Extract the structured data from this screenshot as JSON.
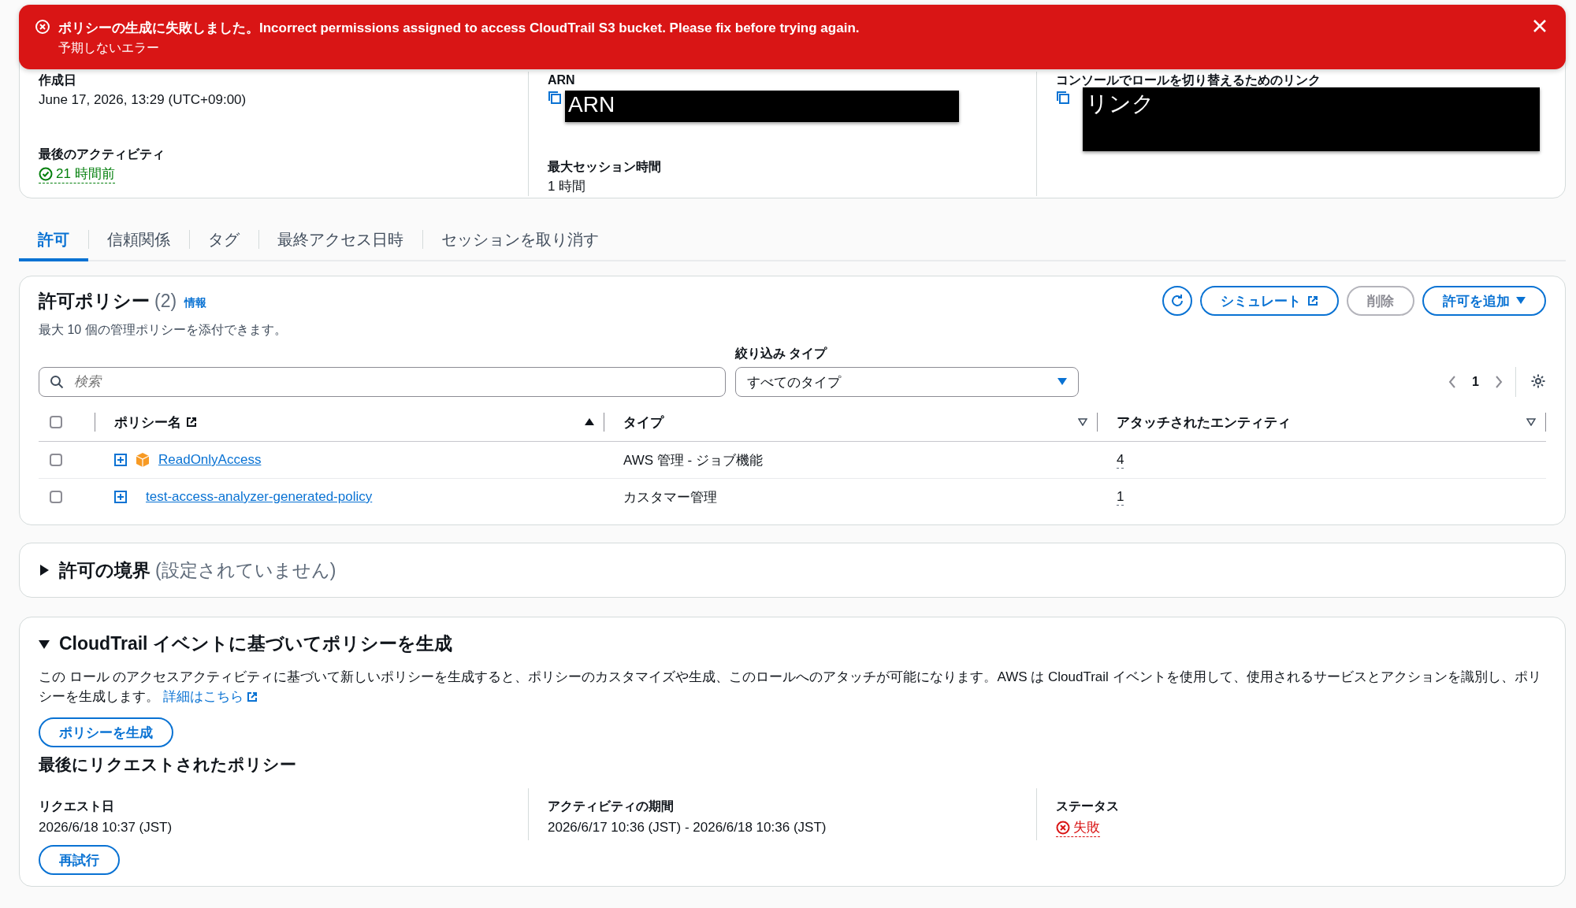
{
  "alert": {
    "message": "ポリシーの生成に失敗しました。Incorrect permissions assigned to access CloudTrail S3 bucket. Please fix before trying again.",
    "detail": "予期しないエラー"
  },
  "summary": {
    "columns": [
      [
        {
          "label": "作成日",
          "value": "June 17, 2026, 13:29 (UTC+09:00)",
          "kind": "text"
        },
        {
          "label": "最後のアクティビティ",
          "value": "21 時間前",
          "kind": "success"
        }
      ],
      [
        {
          "label": "ARN",
          "value": "ARN",
          "kind": "redacted"
        },
        {
          "label": "最大セッション時間",
          "value": "1 時間",
          "kind": "text"
        }
      ],
      [
        {
          "label": "コンソールでロールを切り替えるためのリンク",
          "value": "リンク",
          "kind": "redacted-tall"
        }
      ]
    ]
  },
  "tabs": [
    {
      "label": "許可",
      "selected": true
    },
    {
      "label": "信頼関係",
      "selected": false
    },
    {
      "label": "タグ",
      "selected": false
    },
    {
      "label": "最終アクセス日時",
      "selected": false
    },
    {
      "label": "セッションを取り消す",
      "selected": false
    }
  ],
  "permissions": {
    "title": "許可ポリシー",
    "count": "(2)",
    "info": "情報",
    "description": "最大 10 個の管理ポリシーを添付できます。",
    "buttons": [
      {
        "label": "シミュレート",
        "kind": "external",
        "disabled": false
      },
      {
        "label": "削除",
        "kind": "plain",
        "disabled": true
      },
      {
        "label": "許可を追加",
        "kind": "dropdown",
        "disabled": false
      }
    ],
    "search": {
      "placeholder": "検索"
    },
    "filter": {
      "label": "絞り込み タイプ",
      "value": "すべてのタイプ"
    },
    "pagination": {
      "page": "1"
    },
    "table": {
      "all_checked": false,
      "columns": [
        {
          "label": "ポリシー名",
          "sorted": true,
          "external": true
        },
        {
          "label": "タイプ",
          "sorted": false,
          "external": false
        },
        {
          "label": "アタッチされたエンティティ",
          "sorted": false,
          "external": false
        }
      ],
      "rows": [
        {
          "checked": false,
          "kind": "aws-managed",
          "name": "ReadOnlyAccess",
          "type": "AWS 管理 - ジョブ機能",
          "entities": "4"
        },
        {
          "checked": false,
          "kind": "customer-managed",
          "name": "test-access-analyzer-generated-policy",
          "type": "カスタマー管理",
          "entities": "1"
        }
      ]
    }
  },
  "boundary": {
    "title": "許可の境界",
    "note": "(設定されていません)",
    "expanded": false
  },
  "cloudtrail": {
    "title": "CloudTrail イベントに基づいてポリシーを生成",
    "expanded": true,
    "description": "この ロール のアクセスアクティビティに基づいて新しいポリシーを生成すると、ポリシーのカスタマイズや生成、このロールへのアタッチが可能になります。AWS は CloudTrail イベントを使用して、使用されるサービスとアクションを識別し、ポリシーを生成します。",
    "link": "詳細はこちら",
    "generate_button": "ポリシーを生成",
    "last_title": "最後にリクエストされたポリシー",
    "fields": [
      {
        "label": "リクエスト日",
        "value": "2026/6/18 10:37 (JST)",
        "kind": "text"
      },
      {
        "label": "アクティビティの期間",
        "value": "2026/6/17 10:36 (JST) - 2026/6/18 10:36 (JST)",
        "kind": "text"
      },
      {
        "label": "ステータス",
        "value": "失敗",
        "kind": "error"
      }
    ],
    "retry_button": "再試行"
  }
}
